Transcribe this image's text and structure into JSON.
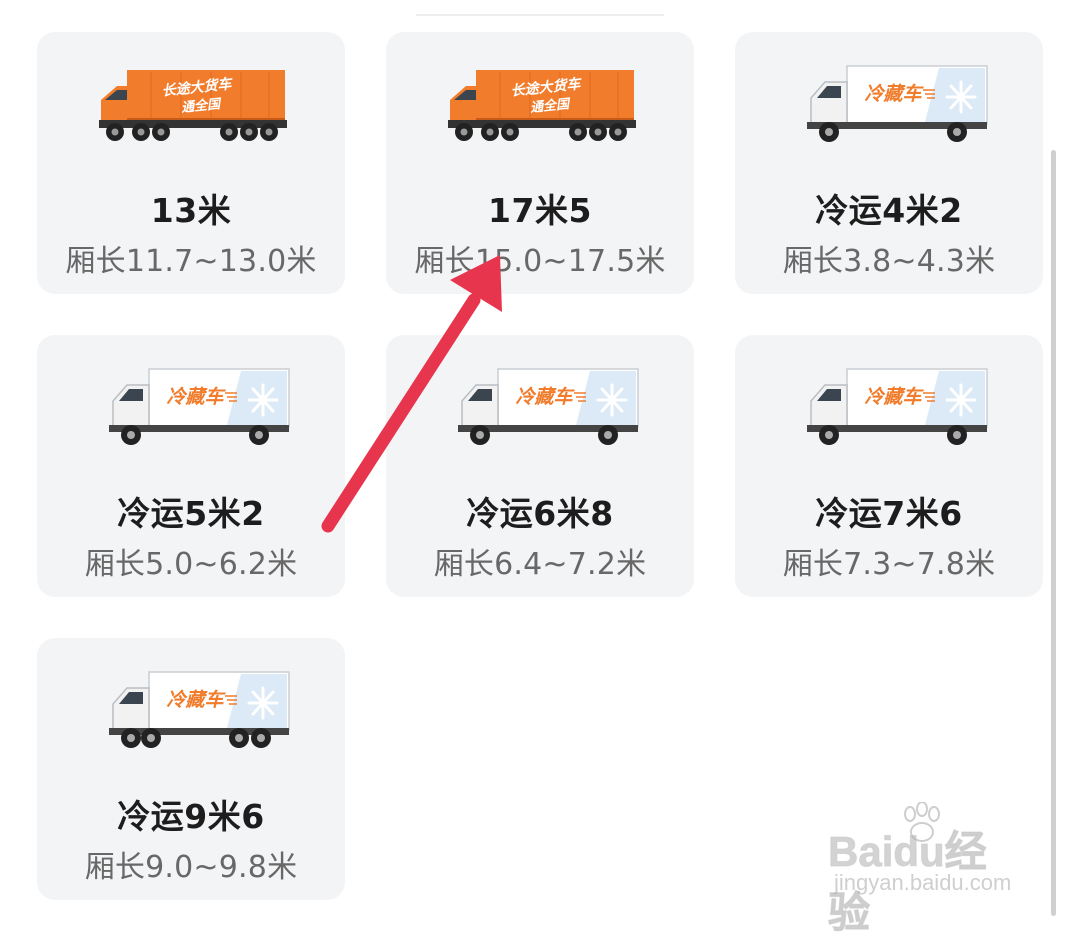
{
  "vehicles": [
    {
      "title": "13米",
      "sub": "厢长11.7~13.0米",
      "type": "long-haul",
      "banner1": "长途大货车",
      "banner2": "通全国"
    },
    {
      "title": "17米5",
      "sub": "厢长15.0~17.5米",
      "type": "long-haul",
      "banner1": "长途大货车",
      "banner2": "通全国"
    },
    {
      "title": "冷运4米2",
      "sub": "厢长3.8~4.3米",
      "type": "refrigerated",
      "banner1": "冷藏车"
    },
    {
      "title": "冷运5米2",
      "sub": "厢长5.0~6.2米",
      "type": "refrigerated",
      "banner1": "冷藏车"
    },
    {
      "title": "冷运6米8",
      "sub": "厢长6.4~7.2米",
      "type": "refrigerated",
      "banner1": "冷藏车"
    },
    {
      "title": "冷运7米6",
      "sub": "厢长7.3~7.8米",
      "type": "refrigerated",
      "banner1": "冷藏车"
    },
    {
      "title": "冷运9米6",
      "sub": "厢长9.0~9.8米",
      "type": "refrigerated",
      "banner1": "冷藏车"
    }
  ],
  "watermark": {
    "brand": "Baidu经验",
    "url": "jingyan.baidu.com"
  },
  "colors": {
    "card_bg": "#f3f4f6",
    "orange": "#f07c2c",
    "arrow": "#e8354e",
    "title": "#1d1d1d",
    "subtitle": "#686868"
  }
}
